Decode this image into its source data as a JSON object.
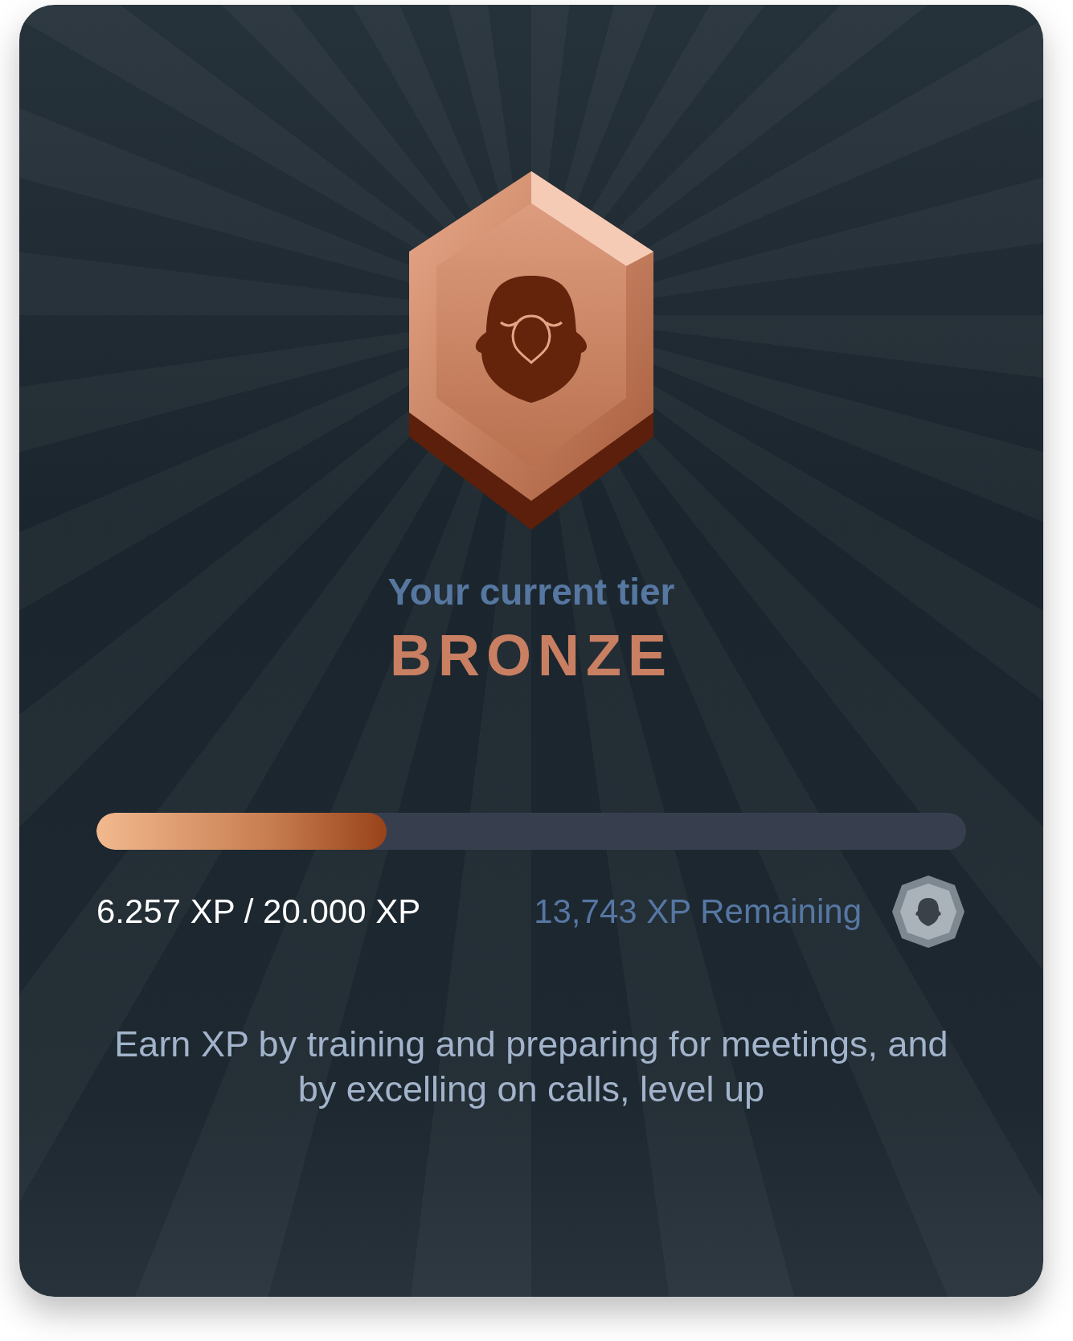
{
  "heading": "Your current tier",
  "tier": "BRONZE",
  "progress": {
    "level": 0.334,
    "current": "6.257 XP / 20.000 XP",
    "remaining": "13,743 XP Remaining"
  },
  "description": "Earn XP by training and preparing for meetings, and by excelling on calls, level up"
}
